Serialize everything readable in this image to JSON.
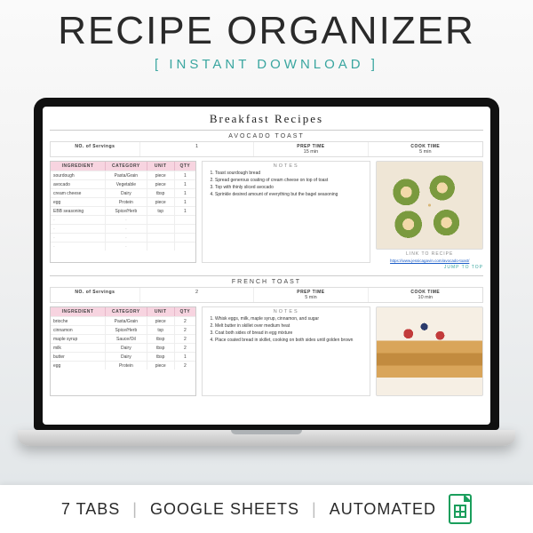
{
  "hero": {
    "title": "RECIPE ORGANIZER",
    "subtitle": "[ INSTANT DOWNLOAD ]"
  },
  "page": {
    "title": "Breakfast Recipes"
  },
  "headers": {
    "servings": "NO. of Servings",
    "prep": "PREP TIME",
    "cook": "COOK TIME",
    "ingredient": "INGREDIENT",
    "category": "CATEGORY",
    "unit": "UNIT",
    "qty": "QTY",
    "notes": "NOTES",
    "link": "LINK TO RECIPE",
    "jump": "JUMP TO TOP"
  },
  "recipes": [
    {
      "name": "AVOCADO TOAST",
      "servings": "1",
      "prep": "15 min",
      "cook": "5 min",
      "link": "https://www.jessicagavin.com/avocado-toast/",
      "ingredients": [
        {
          "name": "sourdough",
          "cat": "Pasta/Grain",
          "unit": "piece",
          "qty": "1"
        },
        {
          "name": "avocado",
          "cat": "Vegetable",
          "unit": "piece",
          "qty": "1"
        },
        {
          "name": "cream cheese",
          "cat": "Dairy",
          "unit": "tbsp",
          "qty": "1"
        },
        {
          "name": "egg",
          "cat": "Protein",
          "unit": "piece",
          "qty": "1"
        },
        {
          "name": "EBB seasoning",
          "cat": "Spice/Herb",
          "unit": "tsp",
          "qty": "1"
        }
      ],
      "notes": [
        "Toast sourdough bread",
        "Spread generous coating of cream cheese on top of toast",
        "Top with thinly sliced avocado",
        "Sprinkle desired amount of everything but the bagel seasoning"
      ]
    },
    {
      "name": "FRENCH TOAST",
      "servings": "2",
      "prep": "5 min",
      "cook": "10 min",
      "link": "",
      "ingredients": [
        {
          "name": "brioche",
          "cat": "Pasta/Grain",
          "unit": "piece",
          "qty": "2"
        },
        {
          "name": "cinnamon",
          "cat": "Spice/Herb",
          "unit": "tsp",
          "qty": "2"
        },
        {
          "name": "maple syrup",
          "cat": "Sauce/Oil",
          "unit": "tbsp",
          "qty": "2"
        },
        {
          "name": "milk",
          "cat": "Dairy",
          "unit": "tbsp",
          "qty": "2"
        },
        {
          "name": "butter",
          "cat": "Dairy",
          "unit": "tbsp",
          "qty": "1"
        },
        {
          "name": "egg",
          "cat": "Protein",
          "unit": "piece",
          "qty": "2"
        }
      ],
      "notes": [
        "Whisk eggs, milk, maple syrup, cinnamon, and sugar",
        "Melt butter in skillet over medium heat",
        "Coat both sides of bread in egg mixture",
        "Place coated bread in skillet, cooking on both sides until golden brown"
      ]
    }
  ],
  "footer": {
    "tabs": "7 TABS",
    "platform": "GOOGLE SHEETS",
    "feature": "AUTOMATED"
  }
}
